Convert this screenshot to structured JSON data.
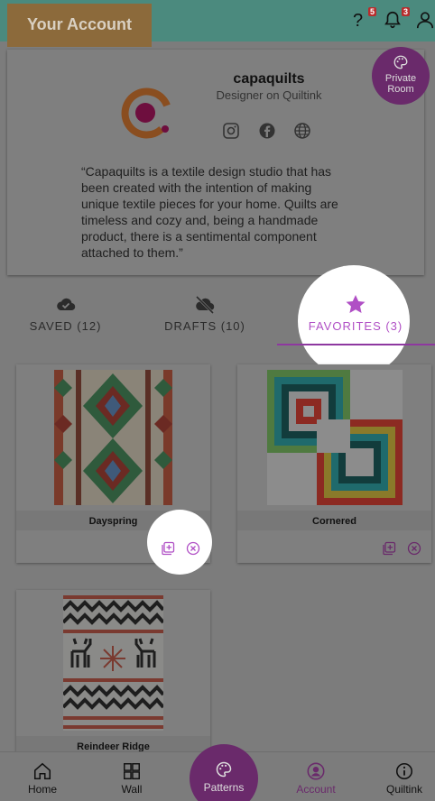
{
  "header": {
    "title": "Your Account",
    "help_badge": "5",
    "notifications_badge": "3"
  },
  "profile": {
    "username": "capaquilts",
    "role": "Designer on Quiltink",
    "quote": "“Capaquilts is a textile design studio that has been created with the intention of making unique textile pieces for your home. Quilts are timeless and cozy and, being a handmade product, there is a sentimental component attached to them.”",
    "social_icons": [
      "instagram-icon",
      "facebook-icon",
      "globe-icon"
    ]
  },
  "private_room": {
    "label_line1": "Private",
    "label_line2": "Room"
  },
  "tabs": [
    {
      "label": "SAVED (12)",
      "icon": "cloud-check-icon"
    },
    {
      "label": "DRAFTS (10)",
      "icon": "cloud-off-icon"
    },
    {
      "label": "FAVORITES (3)",
      "icon": "star-icon"
    }
  ],
  "patterns": [
    {
      "name": "Dayspring"
    },
    {
      "name": "Cornered"
    },
    {
      "name": "Reindeer Ridge"
    }
  ],
  "nav": {
    "home": "Home",
    "wall": "Wall",
    "patterns": "Patterns",
    "account": "Account",
    "quiltink": "Quiltink"
  },
  "colors": {
    "accent": "#b04fc5",
    "brand_purple": "#6a2a6b",
    "header": "#4b8a7e"
  }
}
